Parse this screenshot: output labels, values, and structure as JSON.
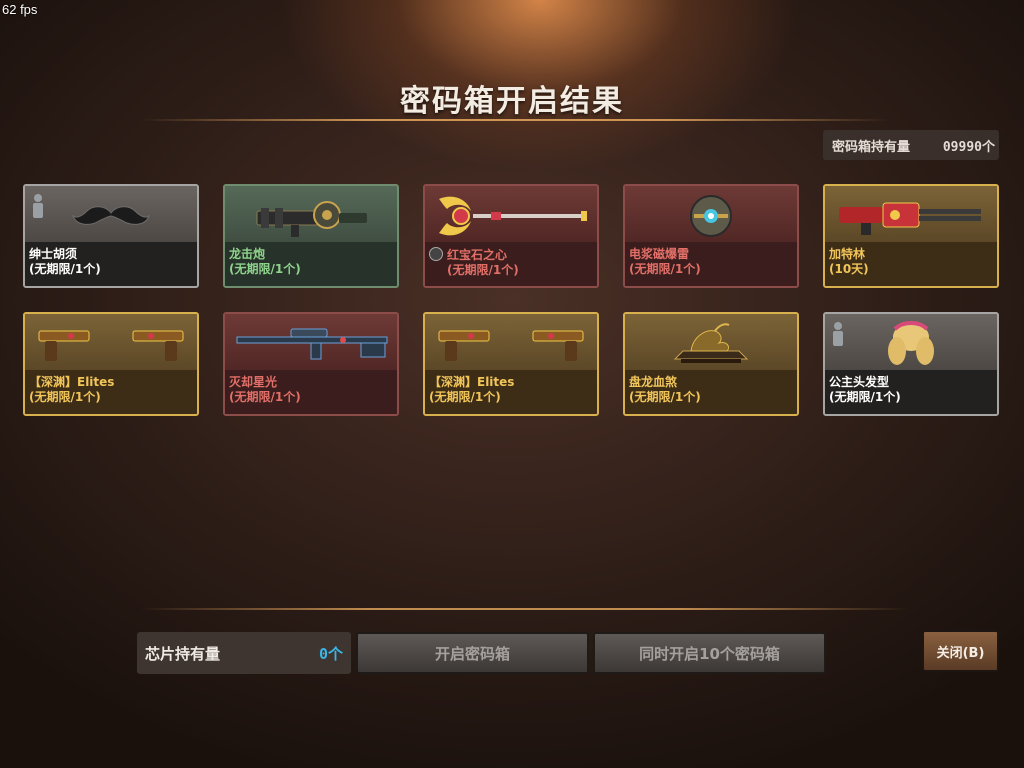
{
  "overlay": {
    "fps": "62 fps"
  },
  "title": "密码箱开启结果",
  "owned": {
    "label": "密码箱持有量",
    "value": "09990个"
  },
  "items": [
    {
      "name": "绅士胡须",
      "duration": "(无期限/1个)",
      "rarity": "gray",
      "icon": "mustache-icon",
      "locked": true
    },
    {
      "name": "龙击炮",
      "duration": "(无期限/1个)",
      "rarity": "green",
      "icon": "cannon-icon",
      "locked": false
    },
    {
      "name": "红宝石之心",
      "duration": "(无期限/1个)",
      "rarity": "red",
      "icon": "staff-icon",
      "locked": false,
      "badge": true
    },
    {
      "name": "电浆磁爆雷",
      "duration": "(无期限/1个)",
      "rarity": "red",
      "icon": "grenade-icon",
      "locked": false
    },
    {
      "name": "加特林",
      "duration": "(10天)",
      "rarity": "gold",
      "icon": "gatling-icon",
      "locked": false
    },
    {
      "name": "【深渊】Elites",
      "duration": "(无期限/1个)",
      "rarity": "gold",
      "icon": "dual-pistols-icon",
      "locked": false
    },
    {
      "name": "灭却星光",
      "duration": "(无期限/1个)",
      "rarity": "red",
      "icon": "sniper-rifle-icon",
      "locked": false
    },
    {
      "name": "【深渊】Elites",
      "duration": "(无期限/1个)",
      "rarity": "gold",
      "icon": "dual-pistols-icon",
      "locked": false
    },
    {
      "name": "盘龙血煞",
      "duration": "(无期限/1个)",
      "rarity": "gold",
      "icon": "dragon-melee-icon",
      "locked": false
    },
    {
      "name": "公主头发型",
      "duration": "(无期限/1个)",
      "rarity": "gray",
      "icon": "hairstyle-icon",
      "locked": true
    }
  ],
  "chip": {
    "label": "芯片持有量",
    "value": "0个"
  },
  "buttons": {
    "open": "开启密码箱",
    "open10": "同时开启10个密码箱",
    "close": "关闭(B)"
  },
  "colors": {
    "gold": "#f1c55a",
    "red": "#e26f68",
    "green": "#8fd38c",
    "chip_value": "#39b7e8"
  }
}
